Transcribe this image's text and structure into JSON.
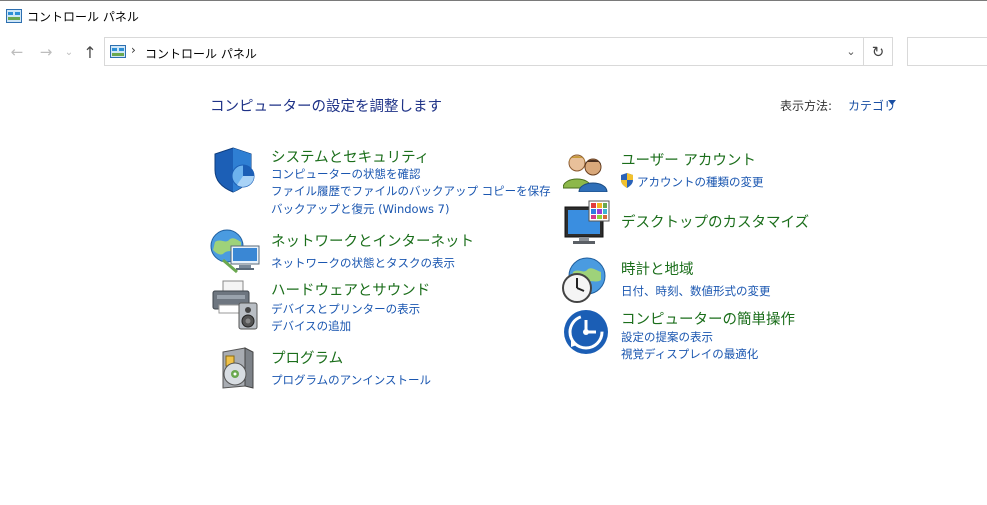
{
  "window": {
    "title": "コントロール パネル"
  },
  "addressbar": {
    "separator": "›",
    "path": "コントロール パネル"
  },
  "nav": {
    "back_icon": "←",
    "forward_icon": "→",
    "recent_icon": "⌄",
    "up_icon": "↑",
    "dropdown_icon": "⌄",
    "refresh_icon": "↻"
  },
  "header": {
    "title": "コンピューターの設定を調整します",
    "view_by_label": "表示方法:",
    "view_by_value": "カテゴリ"
  },
  "categories": {
    "system": {
      "title": "システムとセキュリティ",
      "links": [
        "コンピューターの状態を確認",
        "ファイル履歴でファイルのバックアップ コピーを保存",
        "バックアップと復元 (Windows 7)"
      ]
    },
    "network": {
      "title": "ネットワークとインターネット",
      "links": [
        "ネットワークの状態とタスクの表示"
      ]
    },
    "hardware": {
      "title": "ハードウェアとサウンド",
      "links": [
        "デバイスとプリンターの表示",
        "デバイスの追加"
      ]
    },
    "programs": {
      "title": "プログラム",
      "links": [
        "プログラムのアンインストール"
      ]
    },
    "users": {
      "title": "ユーザー アカウント",
      "links": [
        "アカウントの種類の変更"
      ]
    },
    "appearance": {
      "title": "デスクトップのカスタマイズ",
      "links": []
    },
    "clock": {
      "title": "時計と地域",
      "links": [
        "日付、時刻、数値形式の変更"
      ]
    },
    "ease": {
      "title": "コンピューターの簡単操作",
      "links": [
        "設定の提案の表示",
        "視覚ディスプレイの最適化"
      ]
    }
  },
  "colors": {
    "category_title": "#1b6e1b",
    "link": "#1a56b0",
    "page_title": "#1e3287"
  }
}
